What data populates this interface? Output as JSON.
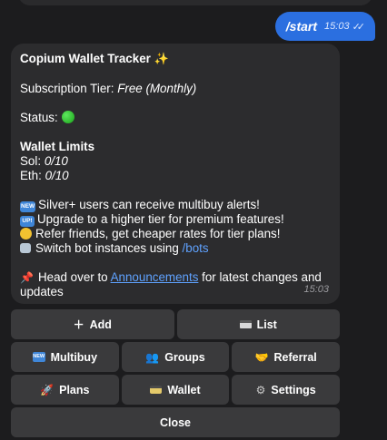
{
  "outgoing": {
    "text": "/start",
    "time": "15:03",
    "status": "read"
  },
  "message": {
    "title": "Copium Wallet Tracker",
    "tier_label": "Subscription Tier:",
    "tier_value": "Free (Monthly)",
    "status_label": "Status:",
    "status_color": "#2ecc40",
    "limits_title": "Wallet Limits",
    "sol_label": "Sol:",
    "sol_value": "0/10",
    "eth_label": "Eth:",
    "eth_value": "0/10",
    "bullets": [
      {
        "icon": "new-icon",
        "badge": "NEW",
        "text": "Silver+ users can receive multibuy alerts!"
      },
      {
        "icon": "up-icon",
        "badge": "UP!",
        "text": "Upgrade to a higher tier for premium features!"
      },
      {
        "icon": "money-face-icon",
        "text": "Refer friends, get cheaper rates for tier plans!"
      },
      {
        "icon": "robot-icon",
        "text": "Switch bot instances using ",
        "link": "/bots"
      }
    ],
    "footer_prefix": "Head over to ",
    "footer_link": "Announcements",
    "footer_suffix_1": " for latest changes and",
    "footer_suffix_2": "updates",
    "time": "15:03"
  },
  "keyboard": {
    "add": "Add",
    "list": "List",
    "multibuy": "Multibuy",
    "groups": "Groups",
    "referral": "Referral",
    "plans": "Plans",
    "wallet": "Wallet",
    "settings": "Settings",
    "close": "Close",
    "new_badge": "NEW"
  },
  "colors": {
    "background": "#1c1c1e",
    "bubble_in": "#2c2c2e",
    "bubble_out": "#2b6fe0",
    "button": "#3a3a3c",
    "link": "#5fa2ff"
  }
}
